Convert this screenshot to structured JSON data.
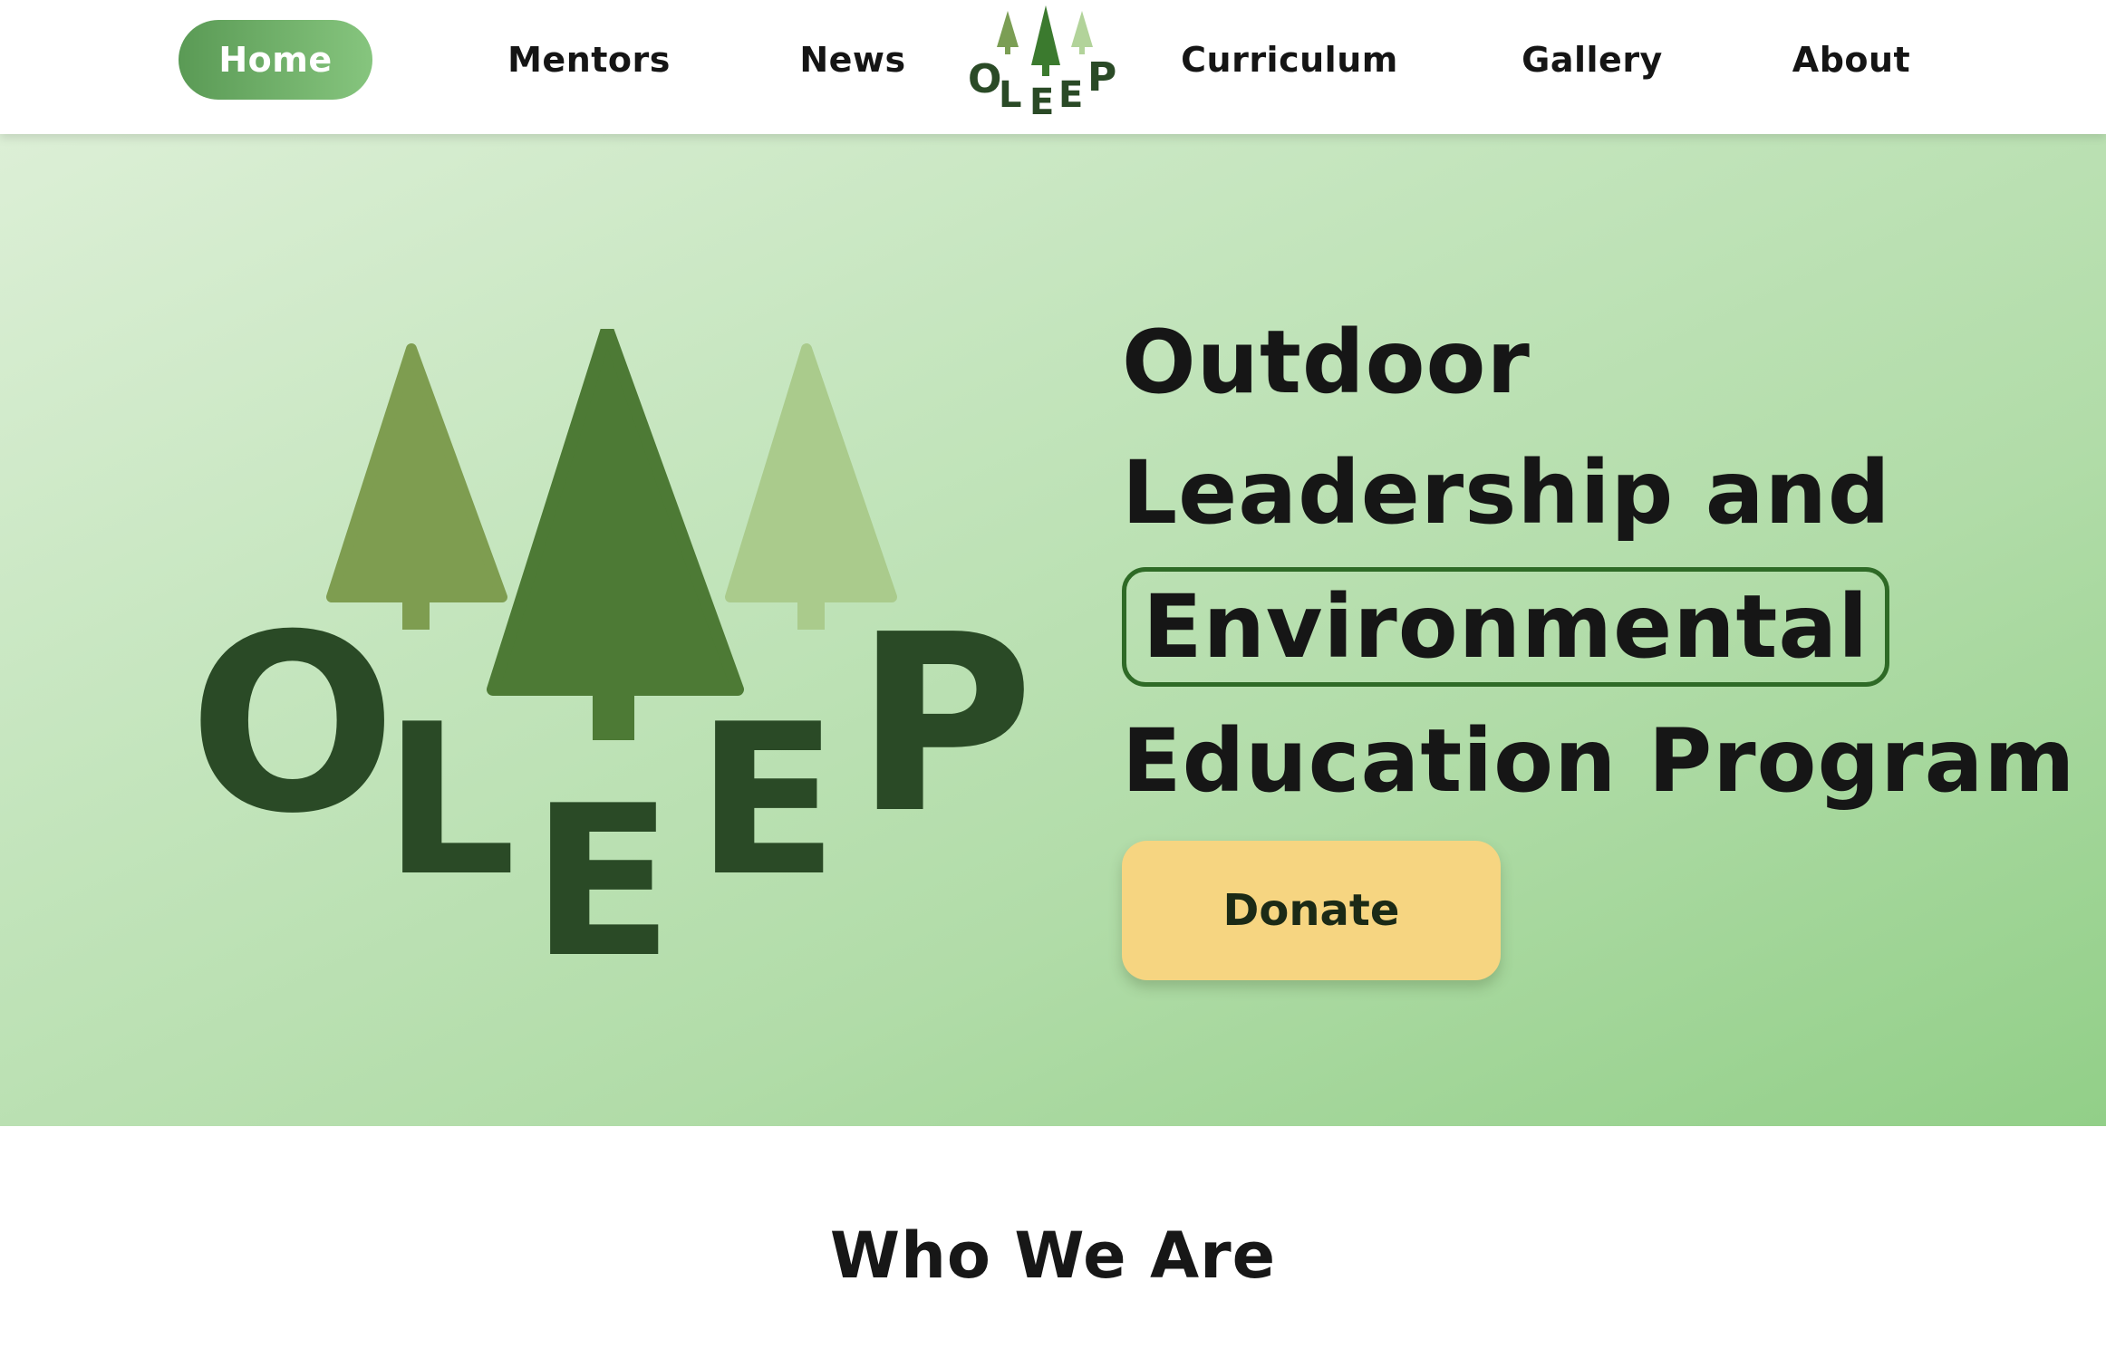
{
  "nav": {
    "items": [
      {
        "label": "Home",
        "active": true
      },
      {
        "label": "Mentors"
      },
      {
        "label": "News"
      },
      {
        "label": "Curriculum"
      },
      {
        "label": "Gallery"
      },
      {
        "label": "About"
      }
    ],
    "logo_icon": "oleep-tree-logo-icon"
  },
  "logo": {
    "letters": [
      "O",
      "L",
      "E",
      "E",
      "P"
    ]
  },
  "hero": {
    "title_lines": [
      "Outdoor",
      "Leadership and",
      "Environmental",
      "Education Program"
    ],
    "highlighted_line": "Environmental",
    "donate_label": "Donate"
  },
  "section": {
    "title": "Who We Are"
  },
  "colors": {
    "accent": "#5a9a55",
    "highlight_border": "#2e6a26",
    "donate": "#f6d581",
    "logo_dark": "#2a4a26"
  }
}
